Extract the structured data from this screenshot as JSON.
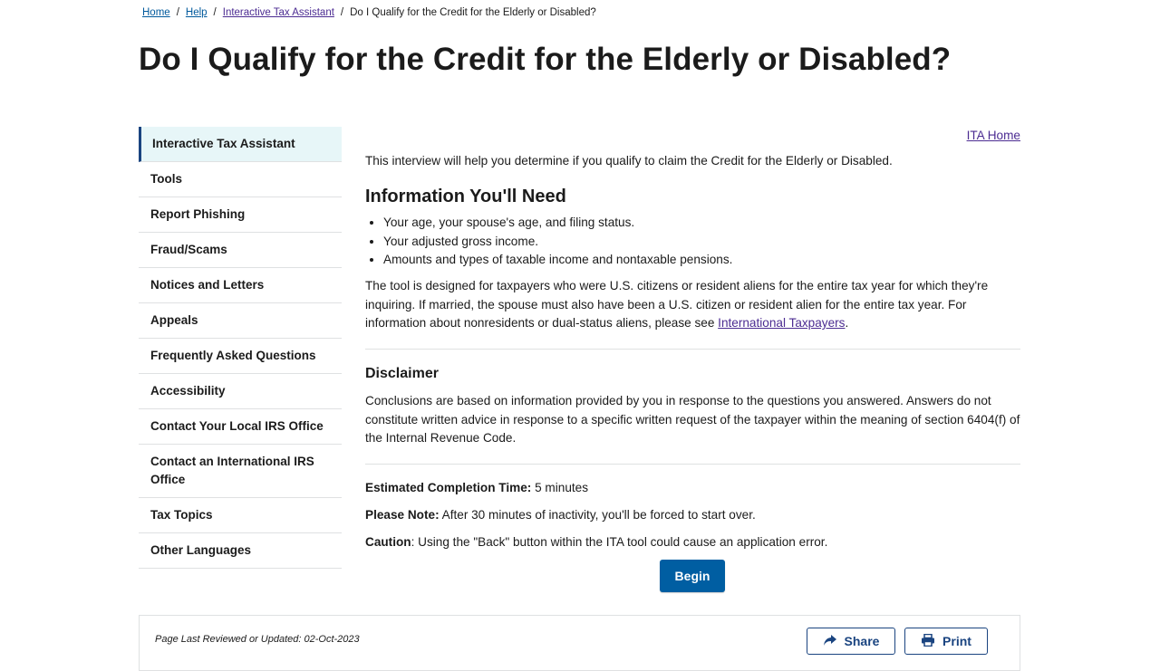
{
  "breadcrumb": {
    "home": "Home",
    "help": "Help",
    "ita": "Interactive Tax Assistant",
    "current": "Do I Qualify for the Credit for the Elderly or Disabled?",
    "separator": "/"
  },
  "page_title": "Do I Qualify for the Credit for the Elderly or Disabled?",
  "sidebar": {
    "items": [
      {
        "label": "Interactive Tax Assistant",
        "active": true
      },
      {
        "label": "Tools"
      },
      {
        "label": "Report Phishing"
      },
      {
        "label": "Fraud/Scams"
      },
      {
        "label": "Notices and Letters"
      },
      {
        "label": "Appeals"
      },
      {
        "label": "Frequently Asked Questions"
      },
      {
        "label": "Accessibility"
      },
      {
        "label": "Contact Your Local IRS Office"
      },
      {
        "label": "Contact an International IRS Office"
      },
      {
        "label": "Tax Topics"
      },
      {
        "label": "Other Languages"
      }
    ]
  },
  "main": {
    "ita_home_link": "ITA Home",
    "intro": "This interview will help you determine if you qualify to claim the Credit for the Elderly or Disabled.",
    "info_heading": "Information You'll Need",
    "info_items": [
      "Your age, your spouse's age, and filing status.",
      "Your adjusted gross income.",
      "Amounts and types of taxable income and nontaxable pensions."
    ],
    "tool_text": "The tool is designed for taxpayers who were U.S. citizens or resident aliens for the entire tax year for which they're inquiring. If married, the spouse must also have been a U.S. citizen or resident alien for the entire tax year. For information about nonresidents or dual-status aliens, please see ",
    "tool_link": "International Taxpayers",
    "tool_end": ".",
    "disclaimer_heading": "Disclaimer",
    "disclaimer_text": "Conclusions are based on information provided by you in response to the questions you answered. Answers do not constitute written advice in response to a specific written request of the taxpayer within the meaning of section 6404(f) of the Internal Revenue Code.",
    "completion_label": "Estimated Completion Time:",
    "completion_value": " 5 minutes",
    "note_label": "Please Note:",
    "note_value": " After 30 minutes of inactivity, you'll be forced to start over.",
    "caution_label": "Caution",
    "caution_value": ": Using the \"Back\" button within the ITA tool could cause an application error.",
    "begin_label": "Begin"
  },
  "footer": {
    "reviewed": "Page Last Reviewed or Updated: 02-Oct-2023",
    "share_label": "Share",
    "print_label": "Print",
    "share_icon": "share-icon",
    "print_icon": "print-icon"
  },
  "colors": {
    "link": "#00599c",
    "visited": "#4c2c92",
    "primary_button": "#005ea2",
    "sidebar_active_bg": "#e7f6f8",
    "sidebar_active_border": "#1a4480"
  }
}
